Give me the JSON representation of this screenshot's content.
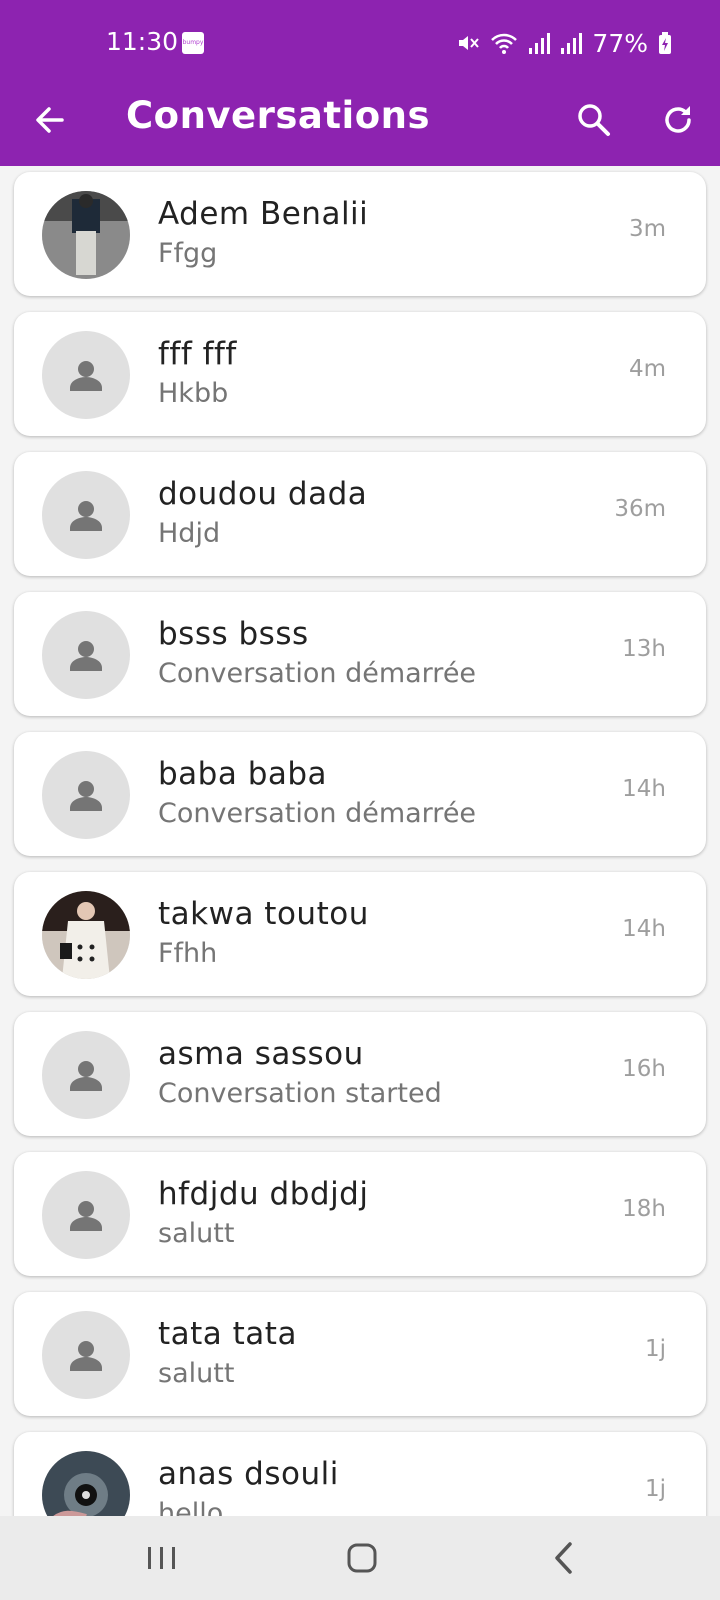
{
  "status_bar": {
    "time": "11:30",
    "app_icon_text": "bumpy",
    "battery": "77%",
    "icons": [
      "mute-icon",
      "wifi-icon",
      "signal-icon",
      "signal-icon",
      "battery-charging-icon"
    ]
  },
  "app_bar": {
    "title": "Conversations",
    "back_icon": "arrow-left-icon",
    "search_icon": "search-icon",
    "refresh_icon": "refresh-icon",
    "color": "#8d23b0"
  },
  "conversations": [
    {
      "name": "Adem Benalii",
      "preview": "Ffgg",
      "time": "3m",
      "avatar": "photo"
    },
    {
      "name": "fff fff",
      "preview": "Hkbb",
      "time": "4m",
      "avatar": "default"
    },
    {
      "name": "doudou dada",
      "preview": "Hdjd",
      "time": "36m",
      "avatar": "default"
    },
    {
      "name": "bsss bsss",
      "preview": "Conversation démarrée",
      "time": "13h",
      "avatar": "default"
    },
    {
      "name": "baba baba",
      "preview": "Conversation démarrée",
      "time": "14h",
      "avatar": "default"
    },
    {
      "name": "takwa toutou",
      "preview": "Ffhh",
      "time": "14h",
      "avatar": "photo"
    },
    {
      "name": "asma sassou",
      "preview": "Conversation started",
      "time": "16h",
      "avatar": "default"
    },
    {
      "name": "hfdjdu dbdjdj",
      "preview": "salutt",
      "time": "18h",
      "avatar": "default"
    },
    {
      "name": "tata tata",
      "preview": "salutt",
      "time": "1j",
      "avatar": "default"
    },
    {
      "name": "anas dsouli",
      "preview": "hello",
      "time": "1j",
      "avatar": "photo"
    }
  ],
  "nav_bar": {
    "icons": [
      "recents-icon",
      "home-icon",
      "back-icon"
    ]
  }
}
